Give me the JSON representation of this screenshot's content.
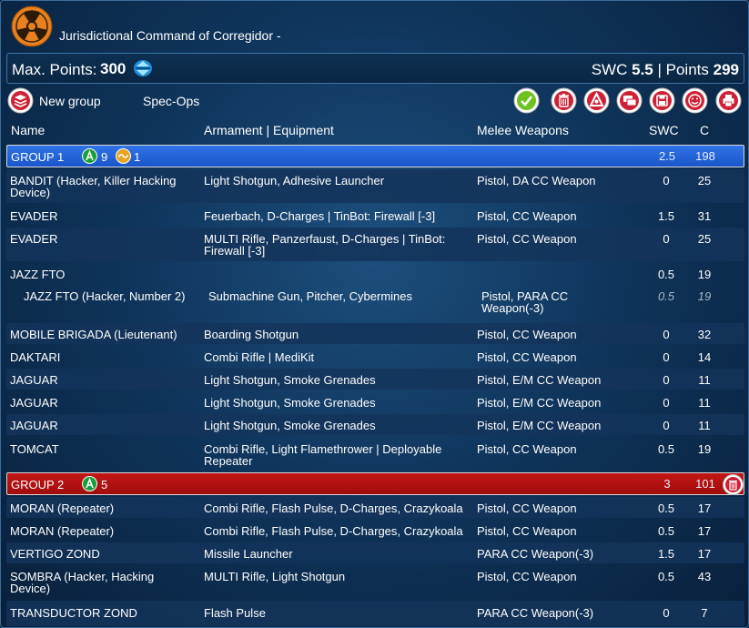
{
  "header": {
    "title": "Jurisdictional Command of Corregidor -"
  },
  "points_bar": {
    "max_label": "Max. Points:",
    "max_value": "300",
    "swc_label": "SWC",
    "swc_value": "5.5",
    "separator": "|",
    "points_label": "Points",
    "points_value": "299"
  },
  "toolbar": {
    "new_group_label": "New group",
    "spec_ops_label": "Spec-Ops",
    "buttons": [
      "validate-icon",
      "trash-icon",
      "army-logo-icon",
      "chat-icon",
      "save-icon",
      "smiley-icon",
      "print-icon"
    ]
  },
  "columns": {
    "name": "Name",
    "armament": "Armament | Equipment",
    "melee": "Melee Weapons",
    "swc": "SWC",
    "points": "C"
  },
  "groups": [
    {
      "label": "GROUP 1",
      "regular_orders": "9",
      "irregular_orders": "1",
      "swc": "2.5",
      "points": "198",
      "units": [
        {
          "name": "BANDIT (Hacker, Killer Hacking Device)",
          "armament": "Light Shotgun, Adhesive Launcher",
          "melee": "Pistol, DA CC Weapon",
          "swc": "0",
          "points": "25"
        },
        {
          "name": "EVADER",
          "armament": "Feuerbach, D-Charges | TinBot: Firewall [-3]",
          "melee": "Pistol, CC Weapon",
          "swc": "1.5",
          "points": "31"
        },
        {
          "name": "EVADER",
          "armament": "MULTI Rifle, Panzerfaust, D-Charges | TinBot: Firewall [-3]",
          "melee": "Pistol, CC Weapon",
          "swc": "0",
          "points": "25"
        },
        {
          "name": "JAZZ FTO",
          "armament": "",
          "melee": "",
          "swc": "0.5",
          "points": "19"
        },
        {
          "name": "JAZZ FTO (Hacker, Number 2)",
          "armament": "Submachine Gun, Pitcher, Cybermines",
          "melee": "Pistol, PARA CC Weapon(-3)",
          "swc": "0.5",
          "points": "19"
        },
        {
          "name": "MOBILE BRIGADA (Lieutenant)",
          "armament": "Boarding Shotgun",
          "melee": "Pistol, CC Weapon",
          "swc": "0",
          "points": "32"
        },
        {
          "name": "DAKTARI",
          "armament": "Combi Rifle | MediKit",
          "melee": "Pistol, CC Weapon",
          "swc": "0",
          "points": "14"
        },
        {
          "name": "JAGUAR",
          "armament": "Light Shotgun, Smoke Grenades",
          "melee": "Pistol, E/M CC Weapon",
          "swc": "0",
          "points": "11"
        },
        {
          "name": "JAGUAR",
          "armament": "Light Shotgun, Smoke Grenades",
          "melee": "Pistol, E/M CC Weapon",
          "swc": "0",
          "points": "11"
        },
        {
          "name": "JAGUAR",
          "armament": "Light Shotgun, Smoke Grenades",
          "melee": "Pistol, E/M CC Weapon",
          "swc": "0",
          "points": "11"
        },
        {
          "name": "TOMCAT",
          "armament": "Combi Rifle, Light Flamethrower | Deployable Repeater",
          "melee": "Pistol, CC Weapon",
          "swc": "0.5",
          "points": "19"
        }
      ]
    },
    {
      "label": "GROUP 2",
      "regular_orders": "5",
      "swc": "3",
      "points": "101",
      "units": [
        {
          "name": "MORAN (Repeater)",
          "armament": "Combi Rifle, Flash Pulse, D-Charges, Crazykoala",
          "melee": "Pistol, CC Weapon",
          "swc": "0.5",
          "points": "17"
        },
        {
          "name": "MORAN (Repeater)",
          "armament": "Combi Rifle, Flash Pulse, D-Charges, Crazykoala",
          "melee": "Pistol, CC Weapon",
          "swc": "0.5",
          "points": "17"
        },
        {
          "name": "VERTIGO ZOND",
          "armament": "Missile Launcher",
          "melee": "PARA CC Weapon(-3)",
          "swc": "1.5",
          "points": "17"
        },
        {
          "name": "SOMBRA (Hacker, Hacking Device)",
          "armament": "MULTI Rifle, Light Shotgun",
          "melee": "Pistol, CC Weapon",
          "swc": "0.5",
          "points": "43"
        },
        {
          "name": "TRANSDUCTOR ZOND",
          "armament": "Flash Pulse",
          "melee": "PARA CC Weapon(-3)",
          "swc": "0",
          "points": "7"
        }
      ]
    }
  ],
  "colors": {
    "group1": "#1f5fd8",
    "group2": "#b31010",
    "background": "#0f355c",
    "accent_orange": "#e8801e"
  }
}
